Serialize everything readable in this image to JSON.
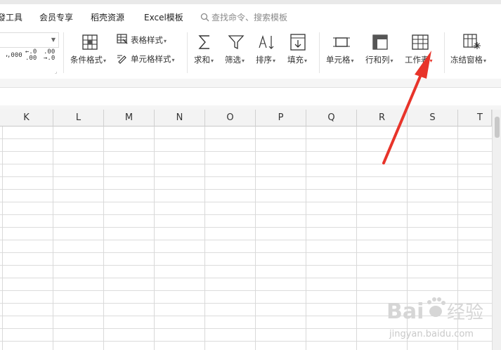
{
  "menubar": {
    "items": [
      "發工具",
      "会员专享",
      "稻壳资源",
      "Excel模板"
    ],
    "search_placeholder": "查找命令、搜索模板"
  },
  "ribbon": {
    "num_formats": {
      "thousands": ",000",
      "inc_a": "←.0",
      "inc_b": ".00",
      "dec_a": ".00",
      "dec_b": "→.0"
    },
    "conditional_format": "条件格式",
    "table_style": "表格样式",
    "cell_style": "单元格样式",
    "sum": "求和",
    "filter": "筛选",
    "sort": "排序",
    "fill": "填充",
    "cell": "单元格",
    "row_col": "行和列",
    "worksheet": "工作表",
    "freeze": "冻结窗格"
  },
  "columns": [
    "K",
    "L",
    "M",
    "N",
    "O",
    "P",
    "Q",
    "R",
    "S",
    "T"
  ],
  "watermark": {
    "brand": "Bai",
    "brand_tail": "经验",
    "url": "jingyan.baidu.com"
  },
  "colors": {
    "arrow": "#e8342a",
    "grid": "#dcdcdc",
    "header_bg": "#f3f3f3"
  }
}
